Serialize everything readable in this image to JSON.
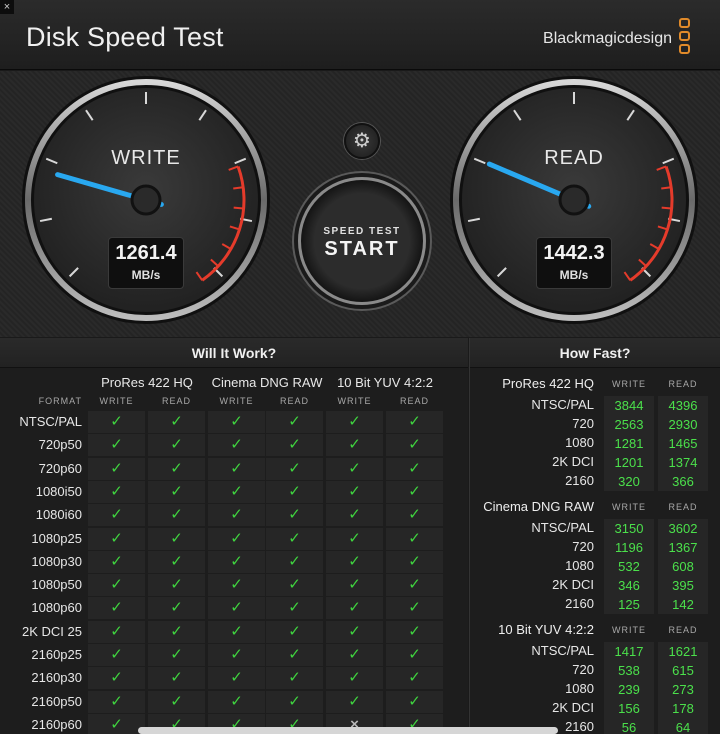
{
  "window": {
    "close_glyph": "×",
    "title": "Disk Speed Test",
    "brand": "Blackmagicdesign"
  },
  "gauges": {
    "write": {
      "label": "WRITE",
      "value": "1261.4",
      "unit": "MB/s"
    },
    "read": {
      "label": "READ",
      "value": "1442.3",
      "unit": "MB/s"
    }
  },
  "start_button": {
    "small": "SPEED TEST",
    "big": "START"
  },
  "settings": {
    "icon": "gear-icon",
    "glyph": "⚙"
  },
  "will_it_work": {
    "title": "Will It Work?",
    "format_header": "FORMAT",
    "write_label": "WRITE",
    "read_label": "READ",
    "groups": [
      "ProRes 422 HQ",
      "Cinema DNG RAW",
      "10 Bit YUV 4:2:2"
    ],
    "check_glyph": "✓",
    "cross_glyph": "×",
    "rows": [
      {
        "format": "NTSC/PAL",
        "results": [
          true,
          true,
          true,
          true,
          true,
          true
        ]
      },
      {
        "format": "720p50",
        "results": [
          true,
          true,
          true,
          true,
          true,
          true
        ]
      },
      {
        "format": "720p60",
        "results": [
          true,
          true,
          true,
          true,
          true,
          true
        ]
      },
      {
        "format": "1080i50",
        "results": [
          true,
          true,
          true,
          true,
          true,
          true
        ]
      },
      {
        "format": "1080i60",
        "results": [
          true,
          true,
          true,
          true,
          true,
          true
        ]
      },
      {
        "format": "1080p25",
        "results": [
          true,
          true,
          true,
          true,
          true,
          true
        ]
      },
      {
        "format": "1080p30",
        "results": [
          true,
          true,
          true,
          true,
          true,
          true
        ]
      },
      {
        "format": "1080p50",
        "results": [
          true,
          true,
          true,
          true,
          true,
          true
        ]
      },
      {
        "format": "1080p60",
        "results": [
          true,
          true,
          true,
          true,
          true,
          true
        ]
      },
      {
        "format": "2K DCI 25",
        "results": [
          true,
          true,
          true,
          true,
          true,
          true
        ]
      },
      {
        "format": "2160p25",
        "results": [
          true,
          true,
          true,
          true,
          true,
          true
        ]
      },
      {
        "format": "2160p30",
        "results": [
          true,
          true,
          true,
          true,
          true,
          true
        ]
      },
      {
        "format": "2160p50",
        "results": [
          true,
          true,
          true,
          true,
          true,
          true
        ]
      },
      {
        "format": "2160p60",
        "results": [
          true,
          true,
          true,
          true,
          false,
          true
        ]
      }
    ]
  },
  "how_fast": {
    "title": "How Fast?",
    "write_label": "WRITE",
    "read_label": "READ",
    "groups": [
      {
        "name": "ProRes 422 HQ",
        "rows": [
          {
            "format": "NTSC/PAL",
            "write": "3844",
            "read": "4396"
          },
          {
            "format": "720",
            "write": "2563",
            "read": "2930"
          },
          {
            "format": "1080",
            "write": "1281",
            "read": "1465"
          },
          {
            "format": "2K DCI",
            "write": "1201",
            "read": "1374"
          },
          {
            "format": "2160",
            "write": "320",
            "read": "366"
          }
        ]
      },
      {
        "name": "Cinema DNG RAW",
        "rows": [
          {
            "format": "NTSC/PAL",
            "write": "3150",
            "read": "3602"
          },
          {
            "format": "720",
            "write": "1196",
            "read": "1367"
          },
          {
            "format": "1080",
            "write": "532",
            "read": "608"
          },
          {
            "format": "2K DCI",
            "write": "346",
            "read": "395"
          },
          {
            "format": "2160",
            "write": "125",
            "read": "142"
          }
        ]
      },
      {
        "name": "10 Bit YUV 4:2:2",
        "rows": [
          {
            "format": "NTSC/PAL",
            "write": "1417",
            "read": "1621"
          },
          {
            "format": "720",
            "write": "538",
            "read": "615"
          },
          {
            "format": "1080",
            "write": "239",
            "read": "273"
          },
          {
            "format": "2K DCI",
            "write": "156",
            "read": "178"
          },
          {
            "format": "2160",
            "write": "56",
            "read": "64"
          }
        ]
      }
    ]
  },
  "colors": {
    "needle": "#29a8f0",
    "redzone": "#e53b2b",
    "check": "#3fd33f",
    "value": "#4be04b",
    "brand": "#e08a2a"
  }
}
